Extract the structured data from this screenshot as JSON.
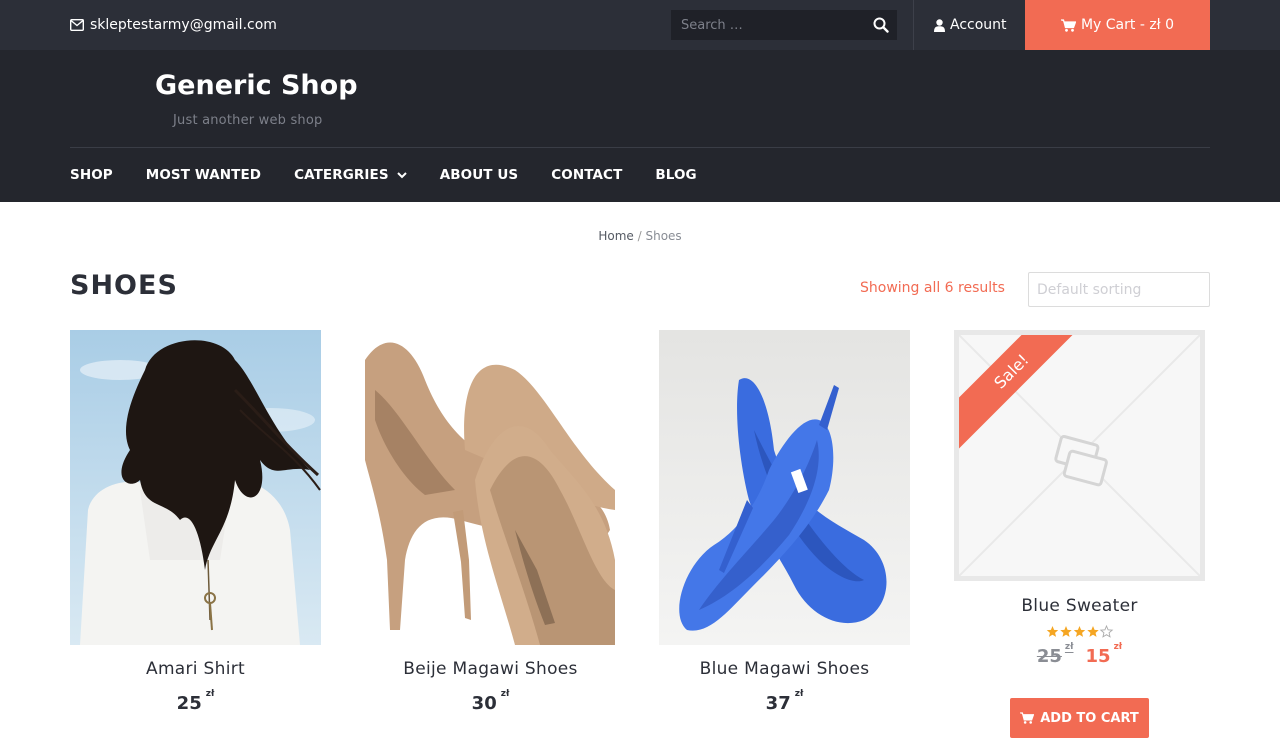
{
  "topbar": {
    "email": "skleptestarmy@gmail.com",
    "search_placeholder": "Search …",
    "account_label": "Account",
    "cart_label": "My Cart - zł 0"
  },
  "header": {
    "site_title": "Generic Shop",
    "tagline": "Just another web shop"
  },
  "nav": {
    "items": [
      "SHOP",
      "MOST WANTED",
      "CATERGRIES",
      "ABOUT US",
      "CONTACT",
      "BLOG"
    ]
  },
  "breadcrumb": {
    "home": "Home",
    "separator": "/",
    "current": "Shoes"
  },
  "page": {
    "title": "SHOES",
    "result_count": "Showing all 6 results",
    "sorting_placeholder": "Default sorting"
  },
  "products": [
    {
      "name": "Amari Shirt",
      "price": "25",
      "currency": "zł"
    },
    {
      "name": "Beije Magawi Shoes",
      "price": "30",
      "currency": "zł"
    },
    {
      "name": "Blue Magawi Shoes",
      "price": "37",
      "currency": "zł"
    },
    {
      "name": "Blue Sweater",
      "old_price": "25",
      "new_price": "15",
      "currency": "zł",
      "sale_label": "Sale!",
      "rating": 4,
      "rating_max": 5,
      "add_to_cart": "ADD TO CART"
    }
  ],
  "colors": {
    "accent": "#f26b53",
    "topbar": "#2c2f38",
    "header": "#24262d"
  }
}
